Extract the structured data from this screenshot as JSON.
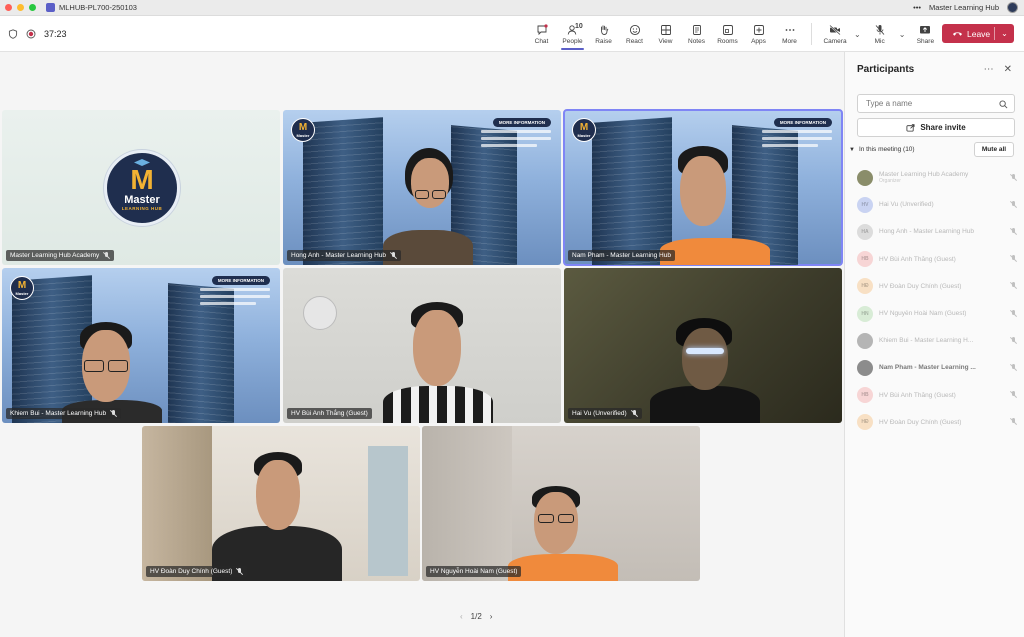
{
  "window": {
    "title": "MLHUB-PL700-250103",
    "more": "•••",
    "account": "Master Learning Hub"
  },
  "colors": {
    "accent": "#5b5fc7",
    "leave": "#c4314b",
    "close": "#ff5f57",
    "minimize": "#febc2e",
    "zoom": "#28c840"
  },
  "toolbar": {
    "timer": "37:23",
    "buttons": [
      {
        "label": "Chat",
        "icon": "chat-icon"
      },
      {
        "label": "People",
        "icon": "people-icon",
        "count": "10"
      },
      {
        "label": "Raise",
        "icon": "hand-icon"
      },
      {
        "label": "React",
        "icon": "smile-icon"
      },
      {
        "label": "View",
        "icon": "grid-icon"
      },
      {
        "label": "Notes",
        "icon": "notes-icon"
      },
      {
        "label": "Rooms",
        "icon": "rooms-icon"
      },
      {
        "label": "Apps",
        "icon": "plus-icon"
      },
      {
        "label": "More",
        "icon": "ellipsis-icon"
      }
    ],
    "camera": "Camera",
    "mic": "Mic",
    "share": "Share",
    "leave": "Leave"
  },
  "tiles": [
    {
      "name": "Master Learning Hub Academy",
      "logo_title": "Master",
      "logo_subtitle": "LEARNING HUB"
    },
    {
      "name": "Hong Anh - Master Learning Hub",
      "info_badge": "MORE INFORMATION",
      "logo_title": "Master"
    },
    {
      "name": "Nam Pham - Master Learning Hub",
      "info_badge": "MORE INFORMATION",
      "logo_title": "Master"
    },
    {
      "name": "Khiem Bui - Master Learning Hub",
      "info_badge": "MORE INFORMATION",
      "logo_title": "Master"
    },
    {
      "name": "HV Bùi Anh Thắng (Guest)"
    },
    {
      "name": "Hai Vu (Unverified)"
    },
    {
      "name": "HV Đoàn Duy Chính (Guest)"
    },
    {
      "name": "HV Nguyễn Hoài Nam (Guest)"
    }
  ],
  "pager": {
    "text": "1/2"
  },
  "panel": {
    "title": "Participants",
    "search_placeholder": "Type a name",
    "share_invite": "Share invite",
    "in_meeting": "In this meeting (10)",
    "mute_all": "Mute all",
    "participants": [
      {
        "name": "Master Learning Hub Academy",
        "sub": "Organizer",
        "avatar_color": "#8a8d6a"
      },
      {
        "name": "Hai Vu (Unverified)",
        "avatar_color": "#c9d3f2",
        "initials": "HV"
      },
      {
        "name": "Hong Anh - Master Learning Hub",
        "avatar_color": "#dcdcdc",
        "initials": "HA"
      },
      {
        "name": "HV Bùi Anh Thắng (Guest)",
        "avatar_color": "#f7d5d5",
        "initials": "HB"
      },
      {
        "name": "HV Đoàn Duy Chính (Guest)",
        "avatar_color": "#f8e0c4",
        "initials": "HĐ"
      },
      {
        "name": "HV Nguyễn Hoài Nam (Guest)",
        "avatar_color": "#d8ecd6",
        "initials": "HN"
      },
      {
        "name": "Khiem Bui - Master Learning H...",
        "avatar_color": "#b5b5b5"
      },
      {
        "name": "Nam Pham - Master Learning ...",
        "avatar_color": "#8c8c8c"
      },
      {
        "name": "HV Bùi Anh Thắng (Guest)",
        "avatar_color": "#f7d5d5",
        "initials": "HB"
      },
      {
        "name": "HV Đoàn Duy Chính (Guest)",
        "avatar_color": "#f8e0c4",
        "initials": "HĐ"
      }
    ]
  }
}
